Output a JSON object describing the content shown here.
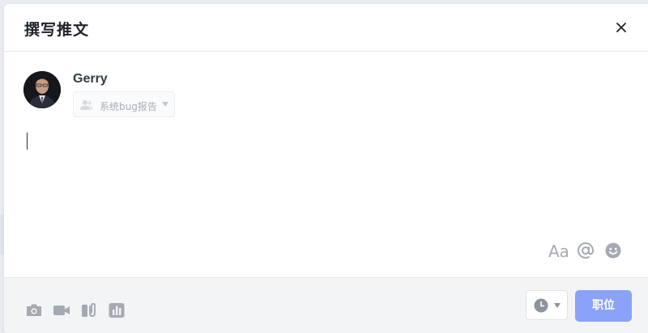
{
  "dialog": {
    "title": "撰写推文",
    "close_icon": "close-icon"
  },
  "author": {
    "name": "Gerry",
    "avatar_icon": "user-photo"
  },
  "audience": {
    "selected": "系统bug报告",
    "icon": "group-icon"
  },
  "editor": {
    "value": ""
  },
  "format_toolbar": {
    "items": [
      {
        "name": "font-format",
        "label": "Aa"
      },
      {
        "name": "mention",
        "icon": "at-icon"
      },
      {
        "name": "emoji",
        "icon": "smiley-icon"
      }
    ]
  },
  "attachments": {
    "items": [
      {
        "name": "photo",
        "icon": "camera-icon"
      },
      {
        "name": "video",
        "icon": "video-icon"
      },
      {
        "name": "file",
        "icon": "attachment-icon"
      },
      {
        "name": "poll",
        "icon": "chart-icon"
      }
    ]
  },
  "actions": {
    "schedule_icon": "clock-icon",
    "post_label": "职位"
  },
  "colors": {
    "accent": "#8aa2f7",
    "icon_gray": "#a5aab2",
    "footer_bg": "#f3f4f6"
  }
}
